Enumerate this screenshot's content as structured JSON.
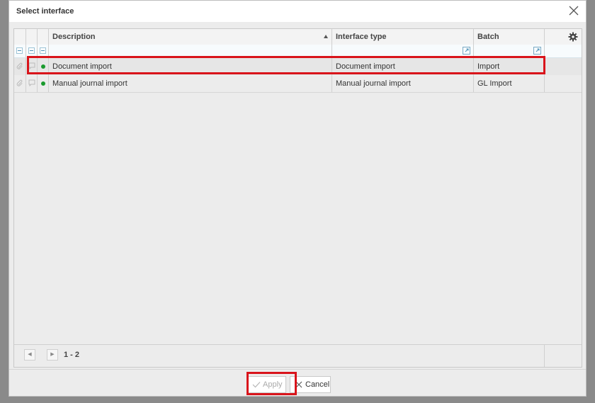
{
  "dialog": {
    "title": "Select interface"
  },
  "grid": {
    "columns": [
      {
        "label": "Description",
        "sort": "ascending"
      },
      {
        "label": "Interface type"
      },
      {
        "label": "Batch"
      }
    ],
    "rows": [
      {
        "description": "Document import",
        "interface_type": "Document import",
        "batch": "Import",
        "status_color": "#1a9a2e",
        "highlighted": true
      },
      {
        "description": "Manual journal import",
        "interface_type": "Manual journal import",
        "batch": "GL Import",
        "status_color": "#1a9a2e",
        "highlighted": false
      }
    ]
  },
  "pager": {
    "range": "1 - 2"
  },
  "buttons": {
    "apply": "Apply",
    "cancel": "Cancel"
  },
  "colors": {
    "highlight": "#d9141b",
    "status_active": "#1a9a2e",
    "filter_accent": "#4a90b8"
  }
}
